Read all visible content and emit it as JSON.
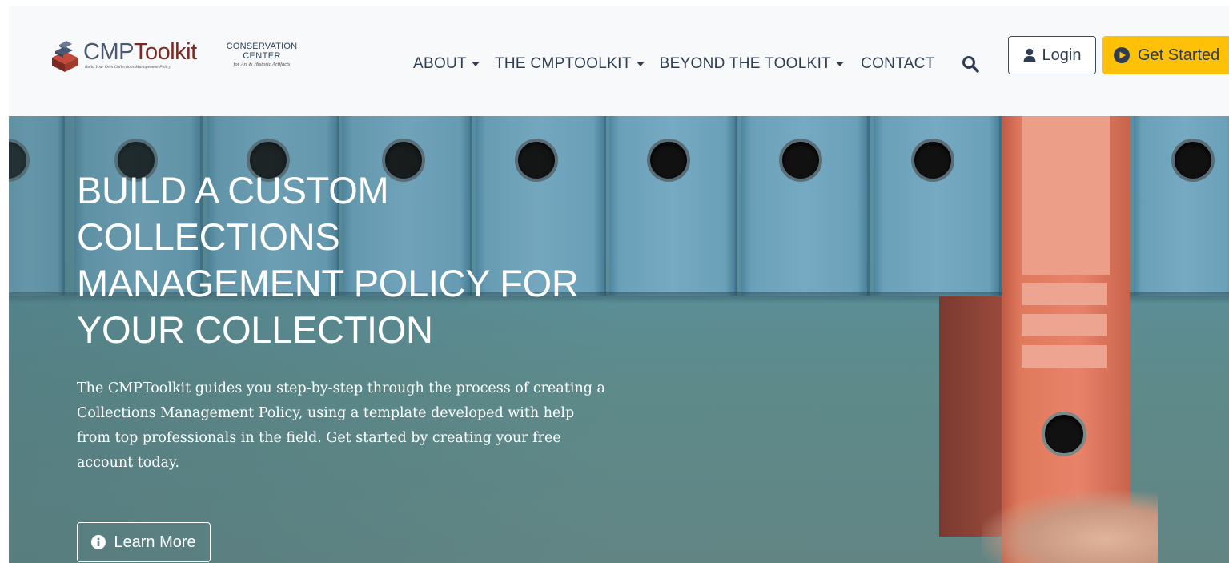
{
  "brand": {
    "name_part1": "CMP",
    "name_part2": "Toolkit",
    "tagline": "Build Your Own Collections Management Policy",
    "logo_icon": "stacked-books-logo"
  },
  "partner": {
    "line1": "CONSERVATION",
    "line2": "CENTER",
    "line3": "for Art & Historic Artifacts"
  },
  "nav": {
    "items": [
      {
        "label": "ABOUT",
        "dropdown": true
      },
      {
        "label": "THE CMPTOOLKIT",
        "dropdown": true
      },
      {
        "label": "BEYOND THE TOOLKIT",
        "dropdown": true
      },
      {
        "label": "CONTACT",
        "dropdown": false
      }
    ],
    "search_icon": "search-icon"
  },
  "actions": {
    "login_label": "Login",
    "login_icon": "user-icon",
    "get_started_label": "Get Started",
    "get_started_icon": "play-circle-icon"
  },
  "hero": {
    "title_lines": [
      "BUILD A CUSTOM",
      "COLLECTIONS",
      "MANAGEMENT POLICY FOR",
      "YOUR COLLECTION"
    ],
    "text": "The CMPToolkit guides you step-by-step through the process of creating a Collections Management Policy, using a template developed with help from top professionals in the field. Get started by creating your free account today.",
    "learn_more_label": "Learn More",
    "learn_more_icon": "info-circle-icon"
  },
  "colors": {
    "accent": "#ffc107",
    "nav_text": "#2f3d52",
    "brand_red": "#7a2a22",
    "header_bg": "#f8f9fa"
  }
}
